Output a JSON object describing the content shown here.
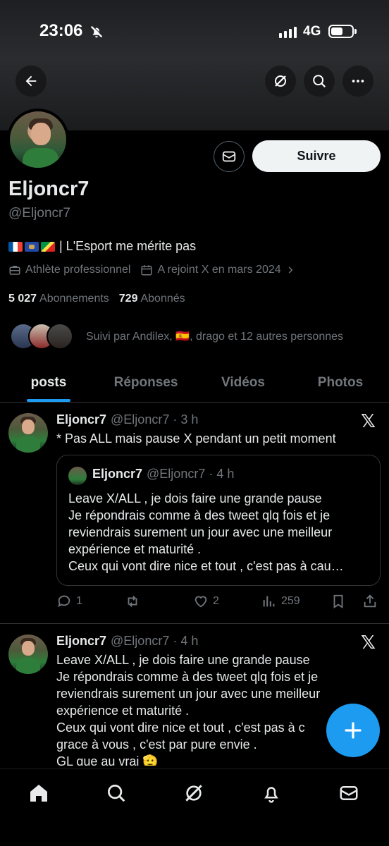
{
  "status_bar": {
    "time": "23:06",
    "network": "4G"
  },
  "profile": {
    "display_name": "Eljoncr7",
    "handle": "@Eljoncr7",
    "bio": "| L'Esport me mérite pas",
    "occupation": "Athlète professionnel",
    "joined": "A rejoint X en mars 2024",
    "following_count": "5 027",
    "following_label": "Abonnements",
    "followers_count": "729",
    "followers_label": "Abonnés",
    "followed_by": "Suivi par Andilex, 🇪🇸, drago et 12 autres personnes",
    "follow_button": "Suivre"
  },
  "tabs": [
    {
      "label": "posts",
      "active": true
    },
    {
      "label": "Réponses",
      "active": false
    },
    {
      "label": "Vidéos",
      "active": false
    },
    {
      "label": "Photos",
      "active": false
    }
  ],
  "tweets": [
    {
      "name": "Eljoncr7",
      "meta": "@Eljoncr7 · 3 h",
      "text": "* Pas ALL mais pause X pendant un petit moment",
      "quote": {
        "name": "Eljoncr7",
        "meta": "@Eljoncr7 · 4 h",
        "text": "Leave X/ALL , je dois faire une grande pause\nJe répondrais comme à des tweet qlq fois  et je reviendrais surement un jour avec une meilleur expérience et maturité .\nCeux qui vont dire nice et tout , c'est pas à cau…"
      },
      "replies": "1",
      "retweets": "",
      "likes": "2",
      "views": "259"
    },
    {
      "name": "Eljoncr7",
      "meta": "@Eljoncr7 · 4 h",
      "text": "Leave X/ALL , je dois faire une grande pause\nJe répondrais comme à des tweet qlq fois  et je reviendrais surement un jour avec une meilleur expérience et maturité .\nCeux qui vont dire nice et tout , c'est pas à c\ngrace à vous , c'est par pure envie .\nGL que au vrai 🫡"
    }
  ],
  "colors": {
    "accent": "#1d9bf0",
    "muted": "#71767b",
    "background": "#000000"
  },
  "icons": {
    "header": [
      "back-arrow-icon",
      "grok-icon",
      "search-icon",
      "more-icon"
    ],
    "bottom_nav": [
      "home-icon",
      "search-icon",
      "grok-icon",
      "notifications-icon",
      "messages-icon"
    ]
  }
}
